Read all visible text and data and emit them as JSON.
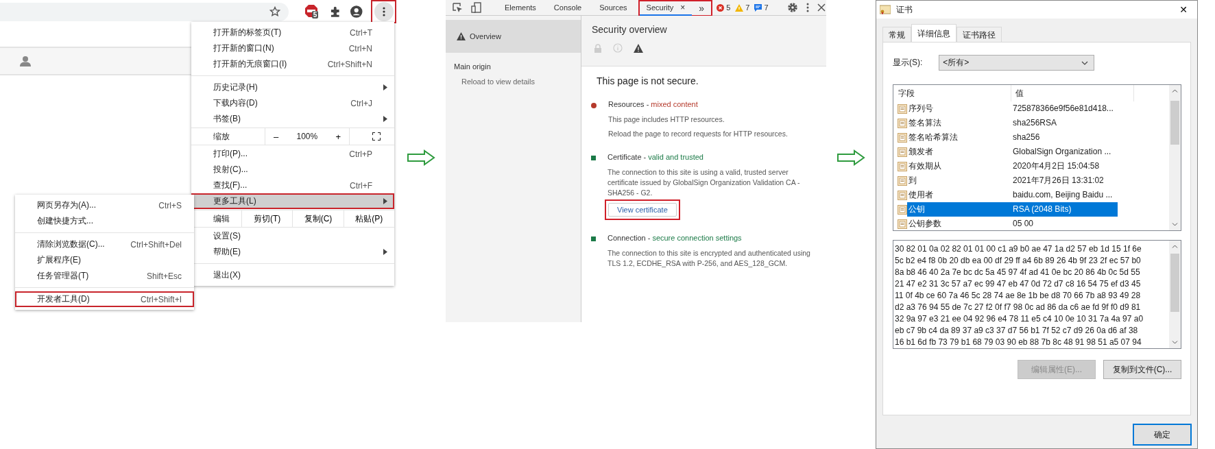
{
  "browser": {
    "extension_badge": "5",
    "menu_button": {
      "annotated": true
    },
    "menu": [
      {
        "kind": "item",
        "label": "打开新的标签页(T)",
        "shortcut": "Ctrl+T",
        "submenu": false,
        "highlighted": false,
        "annotated": false
      },
      {
        "kind": "item",
        "label": "打开新的窗口(N)",
        "shortcut": "Ctrl+N",
        "submenu": false,
        "highlighted": false,
        "annotated": false
      },
      {
        "kind": "item",
        "label": "打开新的无痕窗口(I)",
        "shortcut": "Ctrl+Shift+N",
        "submenu": false,
        "highlighted": false,
        "annotated": false
      },
      {
        "kind": "separator"
      },
      {
        "kind": "item",
        "label": "历史记录(H)",
        "submenu": true,
        "highlighted": false,
        "annotated": false
      },
      {
        "kind": "item",
        "label": "下载内容(D)",
        "shortcut": "Ctrl+J",
        "submenu": false,
        "highlighted": false,
        "annotated": false
      },
      {
        "kind": "item",
        "label": "书签(B)",
        "submenu": true,
        "highlighted": false,
        "annotated": false
      },
      {
        "kind": "zoom",
        "label": "缩放",
        "minus": "–",
        "value": "100%",
        "plus": "+"
      },
      {
        "kind": "item",
        "label": "打印(P)...",
        "shortcut": "Ctrl+P",
        "submenu": false,
        "highlighted": false,
        "annotated": false
      },
      {
        "kind": "item",
        "label": "投射(C)...",
        "submenu": false,
        "highlighted": false,
        "annotated": false
      },
      {
        "kind": "item",
        "label": "查找(F)...",
        "shortcut": "Ctrl+F",
        "submenu": false,
        "highlighted": false,
        "annotated": false
      },
      {
        "kind": "item",
        "label": "更多工具(L)",
        "submenu": true,
        "highlighted": true,
        "annotated": true
      },
      {
        "kind": "edit",
        "label": "编辑",
        "actions": [
          "剪切(T)",
          "复制(C)",
          "粘贴(P)"
        ]
      },
      {
        "kind": "item",
        "label": "设置(S)",
        "submenu": false,
        "highlighted": false,
        "annotated": false
      },
      {
        "kind": "item",
        "label": "帮助(E)",
        "submenu": true,
        "highlighted": false,
        "annotated": false
      },
      {
        "kind": "separator"
      },
      {
        "kind": "item",
        "label": "退出(X)",
        "submenu": false,
        "highlighted": false,
        "annotated": false
      }
    ],
    "submenu": [
      {
        "kind": "item",
        "label": "网页另存为(A)...",
        "shortcut": "Ctrl+S",
        "highlighted": false,
        "annotated": false
      },
      {
        "kind": "item",
        "label": "创建快捷方式...",
        "highlighted": false,
        "annotated": false
      },
      {
        "kind": "separator"
      },
      {
        "kind": "item",
        "label": "清除浏览数据(C)...",
        "shortcut": "Ctrl+Shift+Del",
        "highlighted": false,
        "annotated": false
      },
      {
        "kind": "item",
        "label": "扩展程序(E)",
        "highlighted": false,
        "annotated": false
      },
      {
        "kind": "item",
        "label": "任务管理器(T)",
        "shortcut": "Shift+Esc",
        "highlighted": false,
        "annotated": false
      },
      {
        "kind": "separator"
      },
      {
        "kind": "item",
        "label": "开发者工具(D)",
        "shortcut": "Ctrl+Shift+I",
        "highlighted": false,
        "annotated": true
      }
    ]
  },
  "devtools": {
    "tabs": [
      {
        "label": "Elements",
        "selected": false,
        "annotated": false
      },
      {
        "label": "Console",
        "selected": false,
        "annotated": false
      },
      {
        "label": "Sources",
        "selected": false,
        "annotated": false
      },
      {
        "label": "Security",
        "selected": true,
        "close": "×",
        "annotated": true
      }
    ],
    "overflow": "»",
    "counters": [
      {
        "kind": "error",
        "count": "5"
      },
      {
        "kind": "warning",
        "count": "7"
      },
      {
        "kind": "info",
        "count": "7"
      }
    ],
    "sidebar": {
      "overview": {
        "label": "Overview",
        "selected": true
      },
      "heading": "Main origin",
      "note": "Reload to view details"
    },
    "overview": {
      "title": "Security overview",
      "states": [
        {
          "kind": "lock",
          "selected": false
        },
        {
          "kind": "info",
          "selected": false
        },
        {
          "kind": "warning",
          "selected": true
        }
      ],
      "headline": "This page is not secure.",
      "sections": [
        {
          "kind": "dot",
          "color": "#b53a2c",
          "title": "Resources -",
          "status": "mixed content",
          "paragraphs": [
            "This page includes HTTP resources.",
            "Reload the page to record requests for HTTP resources."
          ]
        },
        {
          "kind": "square",
          "color": "#1b7a47",
          "title": "Certificate -",
          "status": "valid and trusted",
          "paragraphs": [
            "The connection to this site is using a valid, trusted server certificate issued by GlobalSign Organization Validation CA - SHA256 - G2."
          ],
          "button": {
            "label": "View certificate",
            "annotated": true
          }
        },
        {
          "kind": "square",
          "color": "#1b7a47",
          "title": "Connection -",
          "status": "secure connection settings",
          "paragraphs": [
            "The connection to this site is encrypted and authenticated using TLS 1.2, ECDHE_RSA with P-256, and AES_128_GCM."
          ]
        }
      ]
    }
  },
  "dialog": {
    "title": "证书",
    "close": "✕",
    "tabs": [
      {
        "label": "常规",
        "selected": false
      },
      {
        "label": "详细信息",
        "selected": true
      },
      {
        "label": "证书路径",
        "selected": false
      }
    ],
    "show_label": "显示(S):",
    "show_value": "<所有>",
    "columns": [
      "字段",
      "值"
    ],
    "rows": [
      {
        "field": "序列号",
        "value": "725878366e9f56e81d418...",
        "selected": false
      },
      {
        "field": "签名算法",
        "value": "sha256RSA",
        "selected": false
      },
      {
        "field": "签名哈希算法",
        "value": "sha256",
        "selected": false
      },
      {
        "field": "颁发者",
        "value": "GlobalSign Organization ...",
        "selected": false
      },
      {
        "field": "有效期从",
        "value": "2020年4月2日 15:04:58",
        "selected": false
      },
      {
        "field": "到",
        "value": "2021年7月26日 13:31:02",
        "selected": false
      },
      {
        "field": "使用者",
        "value": "baidu.com, Beijing Baidu ...",
        "selected": false
      },
      {
        "field": "公钥",
        "value": "RSA (2048 Bits)",
        "selected": true
      },
      {
        "field": "公钥参数",
        "value": "05 00",
        "selected": false
      }
    ],
    "hex_lines": [
      "30 82 01 0a 02 82 01 01 00 c1 a9 b0 ae 47 1a d2 57 eb 1d 15 1f 6e",
      "5c b2 e4 f8 0b 20 db ea 00 df 29 ff a4 6b 89 26 4b 9f 23 2f ec 57 b0",
      "8a b8 46 40 2a 7e bc dc 5a 45 97 4f ad 41 0e bc 20 86 4b 0c 5d 55",
      "21 47 e2 31 3c 57 a7 ec 99 47 eb 47 0d 72 d7 c8 16 54 75 ef d3 45",
      "11 0f 4b ce 60 7a 46 5c 28 74 ae 8e 1b be d8 70 66 7b a8 93 49 28",
      "d2 a3 76 94 55 de 7c 27 f2 0f f7 98 0c ad 86 da c6 ae fd 9f f0 d9 81",
      "32 9a 97 e3 21 ee 04 92 96 e4 78 11 e5 c4 10 0e 10 31 7a 4a 97 a0",
      "eb c7 9b c4 da 89 37 a9 c3 37 d7 56 b1 7f 52 c7 d9 26 0a d6 af 38",
      "16 b1 6d fb 73 79 b1 68 79 03 90 eb 88 7b 8c 48 91 98 51 a5 07 94"
    ],
    "buttons": [
      {
        "label": "编辑属性(E)...",
        "disabled": true
      },
      {
        "label": "复制到文件(C)...",
        "disabled": false
      }
    ],
    "ok": {
      "label": "确定",
      "default": true
    }
  }
}
